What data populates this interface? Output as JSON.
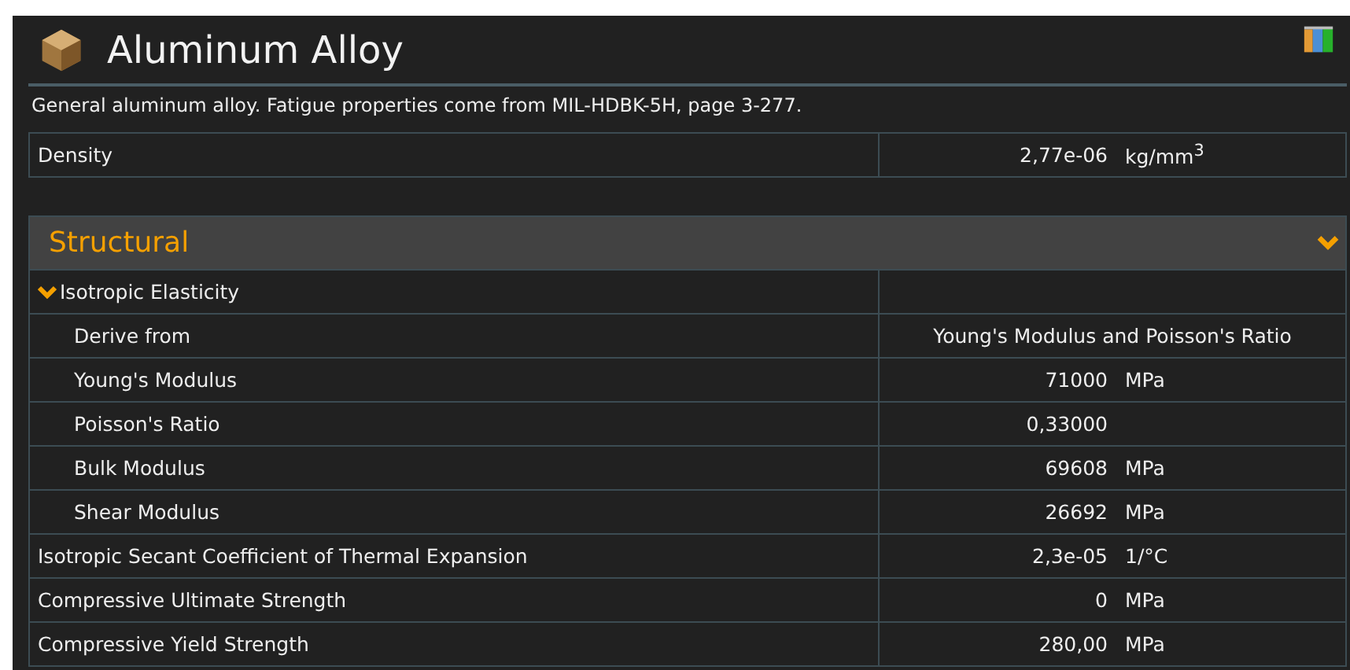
{
  "header": {
    "title": "Aluminum Alloy",
    "description": "General aluminum alloy. Fatigue properties come from MIL-HDBK-5H, page 3-277."
  },
  "top_properties": [
    {
      "label": "Density",
      "value": "2,77e-06",
      "unit": "kg/mm$^{3}$"
    }
  ],
  "section": {
    "title": "Structural",
    "expanded": true,
    "rows": [
      {
        "kind": "group",
        "label": "Isotropic Elasticity",
        "expanded": true,
        "children": [
          {
            "kind": "choice",
            "label": "Derive from",
            "value": "Young's Modulus and Poisson's Ratio"
          },
          {
            "kind": "value",
            "label": "Young's Modulus",
            "value": "71000",
            "unit": "MPa"
          },
          {
            "kind": "value",
            "label": "Poisson's Ratio",
            "value": "0,33000"
          },
          {
            "kind": "value",
            "label": "Bulk Modulus",
            "value": "69608",
            "unit": "MPa"
          },
          {
            "kind": "value",
            "label": "Shear Modulus",
            "value": "26692",
            "unit": "MPa"
          }
        ]
      },
      {
        "kind": "value",
        "label": "Isotropic Secant Coefficient of Thermal Expansion",
        "value": "2,3e-05",
        "unit": "1/°C"
      },
      {
        "kind": "value",
        "label": "Compressive Ultimate Strength",
        "value": "0",
        "unit": "MPa"
      },
      {
        "kind": "value",
        "label": "Compressive Yield Strength",
        "value": "280,00",
        "unit": "MPa"
      }
    ]
  }
}
